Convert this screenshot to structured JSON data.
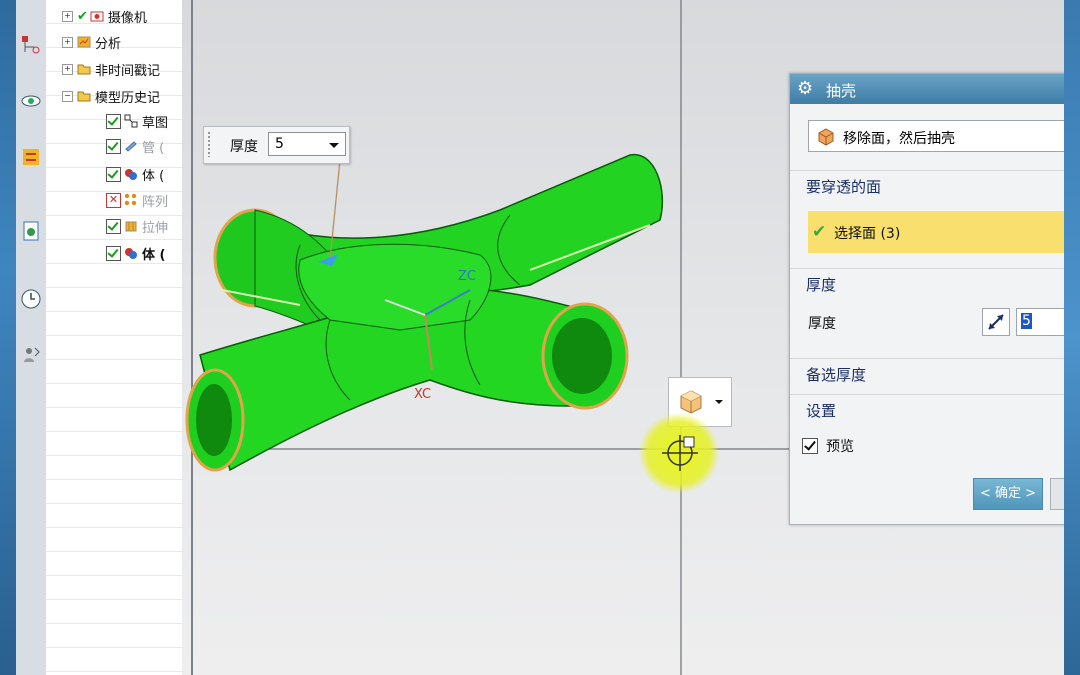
{
  "navigator": {
    "items": [
      {
        "label": "摄像机",
        "state": "checked"
      },
      {
        "label": "分析",
        "state": "none"
      },
      {
        "label": "非时间戳记",
        "state": "none"
      },
      {
        "label": "模型历史记",
        "state": "none"
      },
      {
        "label": "草图",
        "state": "checked"
      },
      {
        "label": "管 (",
        "state": "checked"
      },
      {
        "label": "体 (",
        "state": "checked"
      },
      {
        "label": "阵列",
        "state": "error"
      },
      {
        "label": "拉伸",
        "state": "checked"
      },
      {
        "label": "体 (",
        "state": "checked"
      }
    ]
  },
  "viewport": {
    "thickness_popup": {
      "label": "厚度",
      "value": "5"
    },
    "axis_labels": {
      "zc": "ZC",
      "xc": "XC"
    }
  },
  "dialog": {
    "title": "抽壳",
    "type_label": "移除面，然后抽壳",
    "faces_section": "要穿透的面",
    "select_face": "选择面 (3)",
    "thickness_section": "厚度",
    "thickness_label": "厚度",
    "thickness_value": "5",
    "alt_thickness_section": "备选厚度",
    "settings_section": "设置",
    "preview_label": "预览",
    "ok_button": "< 确定 >"
  },
  "colors": {
    "model": "#1fd21f",
    "face_highlight": "#f8df6e",
    "title_bar": "#4f8db4"
  }
}
